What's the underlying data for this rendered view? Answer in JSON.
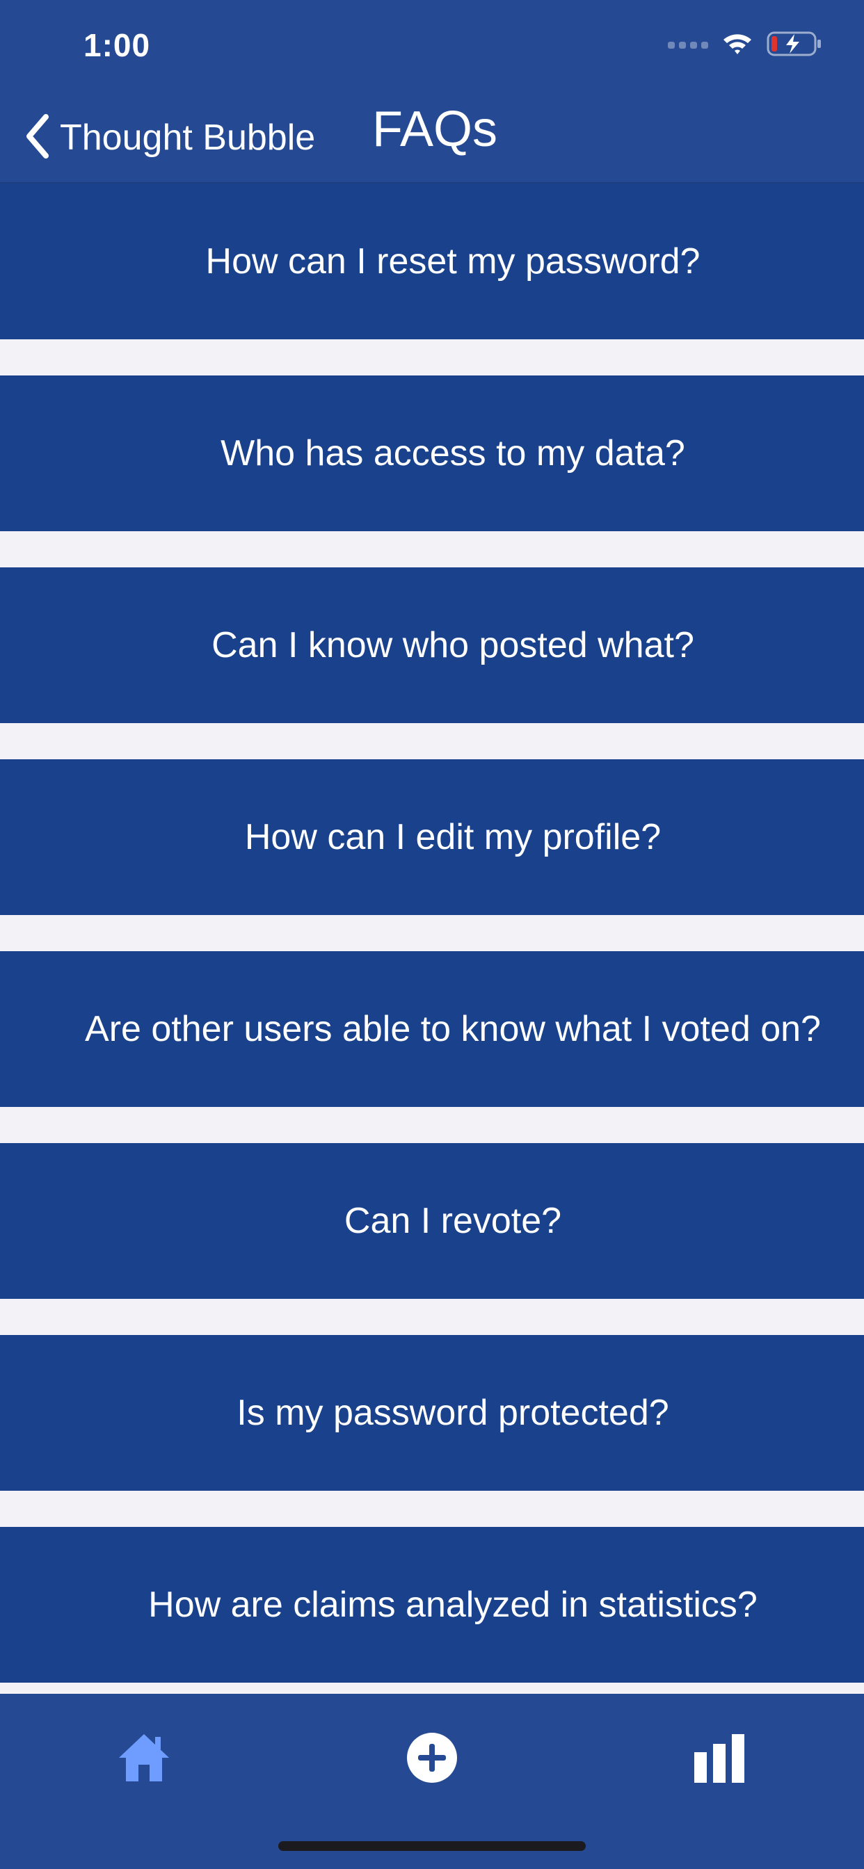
{
  "status_bar": {
    "time": "1:00",
    "icons": [
      "cellular-signal-icon",
      "wifi-icon",
      "battery-charging-icon"
    ],
    "battery_color": "#e0332d"
  },
  "nav_bar": {
    "back_label": "Thought Bubble",
    "title": "FAQs",
    "background": "#254a93"
  },
  "faqs": [
    {
      "question": "How can I reset my password?"
    },
    {
      "question": "Who has access to my data?"
    },
    {
      "question": "Can I know who posted what?"
    },
    {
      "question": "How can I edit my profile?"
    },
    {
      "question": "Are other users able to know what I voted on?"
    },
    {
      "question": "Can I revote?"
    },
    {
      "question": "Is my password protected?"
    },
    {
      "question": "How are claims analyzed in statistics?"
    }
  ],
  "tab_bar": {
    "tabs": [
      {
        "icon": "home-icon",
        "selected": true
      },
      {
        "icon": "add-circle-icon",
        "selected": false
      },
      {
        "icon": "bar-chart-icon",
        "selected": false
      }
    ],
    "selected_color": "#6f9cff",
    "unselected_color": "#ffffff"
  },
  "colors": {
    "nav_background": "#254a93",
    "faq_background": "#1a418c",
    "page_background": "#f2f2f7"
  }
}
